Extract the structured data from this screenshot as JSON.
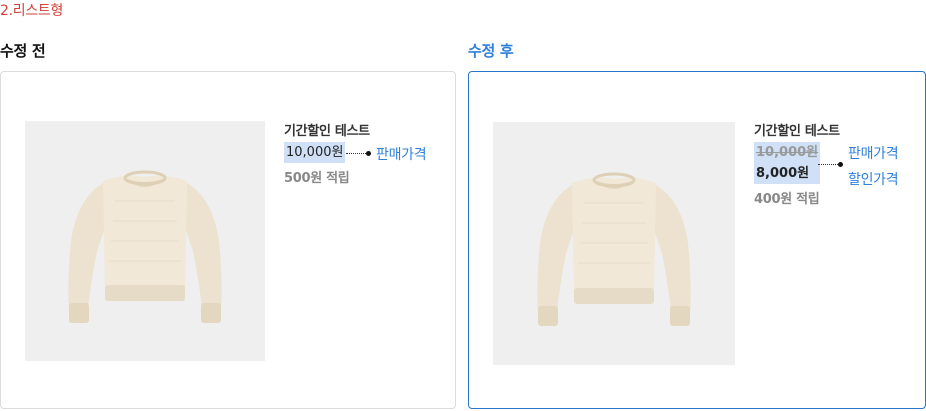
{
  "section_title": "2.리스트형",
  "before": {
    "title": "수정 전",
    "product_name": "기간할인 테스트",
    "price": "10,000원",
    "point": "500원 적립",
    "callout": "판매가격"
  },
  "after": {
    "title": "수정 후",
    "product_name": "기간할인 테스트",
    "original_price": "10,000원",
    "sale_price": "8,000원",
    "point": "400원 적립",
    "callout_price": "판매가격",
    "callout_sale": "할인가격"
  },
  "colors": {
    "section_title": "#d0423b",
    "accent": "#2f7fdb",
    "highlight": "#cfe0f7",
    "after_border": "#2a75cc"
  }
}
